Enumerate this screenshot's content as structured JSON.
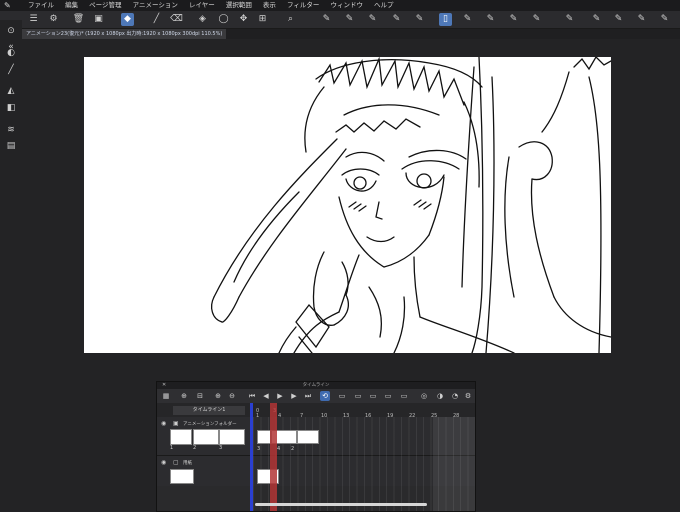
{
  "menu": {
    "items": [
      "ファイル",
      "編集",
      "ページ管理",
      "アニメーション",
      "レイヤー",
      "選択範囲",
      "表示",
      "フィルター",
      "ウィンドウ",
      "ヘルプ"
    ]
  },
  "document": {
    "tab_label": "アニメーション23(復元)* (1920 x 1080px 出力時:1920 x 1080px 300dpi 110.5%)"
  },
  "timeline": {
    "title": "タイムライン",
    "name": "タイムライン1",
    "frame_numbers": [
      "0",
      "1",
      "4",
      "7",
      "10",
      "13",
      "16",
      "19",
      "22",
      "25",
      "28"
    ],
    "current_frame": "3",
    "track1_label": "アニメーションフォルダー",
    "track2_label": "用紙",
    "cell_labels": [
      "1",
      "2",
      "3",
      "3",
      "4",
      "2"
    ]
  },
  "colors": {
    "playhead_start": "#2a3fd1",
    "current_frame_marker": "#b23535",
    "accent": "#4e78b8"
  }
}
